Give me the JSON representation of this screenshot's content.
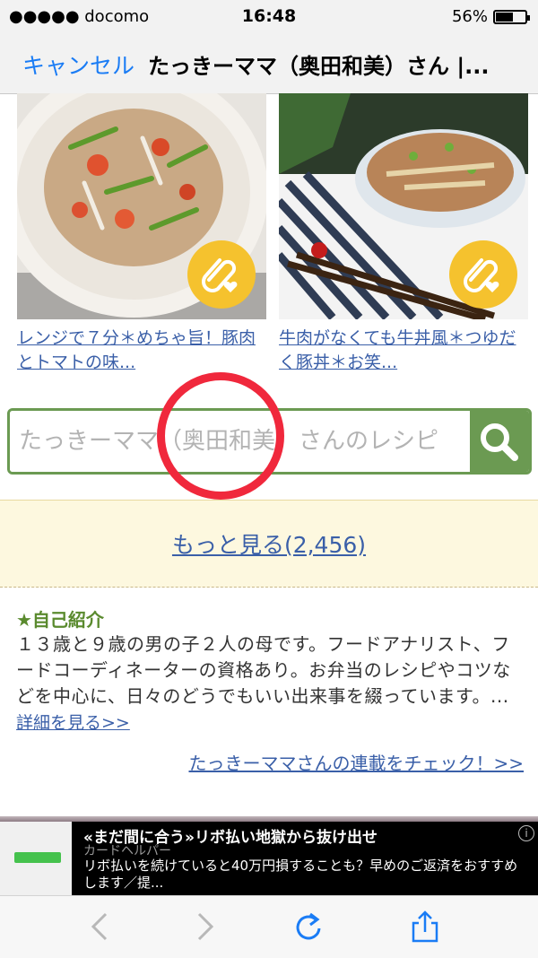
{
  "status": {
    "carrier": "●●●●● docomo",
    "time": "16:48",
    "battery": "56%",
    "battery_level": 0.56
  },
  "nav": {
    "cancel": "キャンセル",
    "title": "たっきーママ（奥田和美）さん |..."
  },
  "recipes": [
    {
      "title": "レンジで７分＊めちゃ旨！豚肉とトマトの味...",
      "icon": "clip-heart-icon"
    },
    {
      "title": "牛肉がなくても牛丼風＊つゆだく豚丼＊お笑...",
      "icon": "clip-heart-icon"
    }
  ],
  "search": {
    "placeholder": "たっきーママ（奥田和美）さんのレシピ",
    "icon": "search-icon",
    "accent": "#6b9a52"
  },
  "more": {
    "label": "もっと見る(2,456)"
  },
  "intro": {
    "heading": "★自己紹介",
    "text": "１３歳と９歳の男の子２人の母です。フードアナリスト、フードコーディネーターの資格あり。お弁当のレシピやコツなどを中心に、日々のどうでもいい出来事を綴っています。...",
    "detail": "詳細を見る>>"
  },
  "serial_link": "たっきーママさんの連載をチェック！>>",
  "ad": {
    "headline": "«まだ間に合う»リボ払い地獄から抜け出せ",
    "source": "カードヘルパー",
    "body": "リボ払いを続けていると40万円損することも？早めのご返済をおすすめします／提..."
  },
  "toolbar": {
    "icons": [
      "back-icon",
      "forward-icon",
      "reload-icon",
      "share-icon"
    ]
  }
}
